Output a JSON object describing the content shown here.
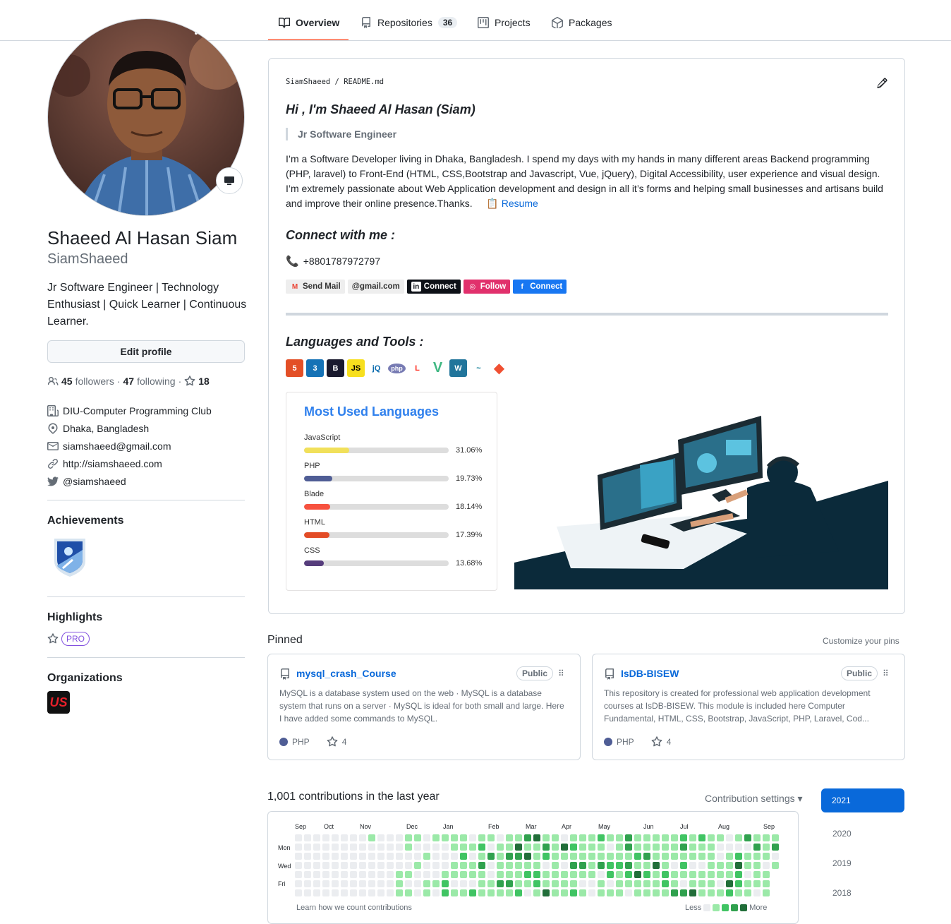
{
  "tabs": [
    {
      "label": "Overview",
      "icon": "book-icon",
      "active": true
    },
    {
      "label": "Repositories",
      "icon": "repo-icon",
      "count": "36"
    },
    {
      "label": "Projects",
      "icon": "project-icon"
    },
    {
      "label": "Packages",
      "icon": "package-icon"
    }
  ],
  "profile": {
    "full_name": "Shaeed Al Hasan Siam",
    "username": "SiamShaeed",
    "bio": "Jr Software Engineer | Technology Enthusiast | Quick Learner | Continuous Learner.",
    "edit_label": "Edit profile",
    "followers_count": "45",
    "followers_label": "followers",
    "following_count": "47",
    "following_label": "following",
    "stars_count": "18",
    "org": "DIU-Computer Programming Club",
    "location": "Dhaka, Bangladesh",
    "email": "siamshaeed@gmail.com",
    "website": "http://siamshaeed.com",
    "twitter": "@siamshaeed"
  },
  "sidebar": {
    "achievements_heading": "Achievements",
    "highlights_heading": "Highlights",
    "pro_label": "PRO",
    "organizations_heading": "Organizations",
    "org_badge_text": "US"
  },
  "readme": {
    "path_user": "SiamShaeed",
    "path_sep": "/",
    "path_file": "README.md",
    "greeting": "Hi , I'm Shaeed Al Hasan (Siam)",
    "role": "Jr Software Engineer",
    "about": "I’m a Software Developer living in Dhaka, Bangladesh. I spend my days with my hands in many different areas Backend programming (PHP, laravel) to Front-End (HTML, CSS,Bootstrap and Javascript, Vue, jQuery), Digital Accessibility, user experience and visual design. I’m extremely passionate about Web Application development and design in all it’s forms and helping small businesses and artisans build and improve their online presence.Thanks.",
    "resume_label": "Resume",
    "connect_heading": "Connect with me :",
    "phone": "+8801787972797",
    "badges": [
      {
        "label": "Send Mail",
        "icon": "gmail-icon",
        "bg": "#eeeeee",
        "fg": "#333333"
      },
      {
        "label": "@gmail.com",
        "icon": "",
        "bg": "#eeeeee",
        "fg": "#333333"
      },
      {
        "label": "Connect",
        "icon": "linkedin-icon",
        "bg": "#0d1117",
        "fg": "#ffffff"
      },
      {
        "label": "Follow",
        "icon": "instagram-icon",
        "bg": "#0d1117",
        "fg": "#ffffff"
      },
      {
        "label": "Connect",
        "icon": "facebook-icon",
        "bg": "#0d1117",
        "fg": "#ffffff"
      }
    ],
    "languages_heading": "Languages and Tools :",
    "tools": [
      {
        "name": "html5-icon",
        "glyph": "5",
        "bg": "#e34f26"
      },
      {
        "name": "css3-icon",
        "glyph": "3",
        "bg": "#1572b6"
      },
      {
        "name": "bootstrap-icon",
        "glyph": "B",
        "bg": "#1a1a2e"
      },
      {
        "name": "javascript-icon",
        "glyph": "JS",
        "bg": "#f7df1e"
      },
      {
        "name": "jquery-icon",
        "glyph": "jQ",
        "bg": "#ffffff"
      },
      {
        "name": "php-icon",
        "glyph": "php",
        "bg": "#777bb3"
      },
      {
        "name": "laravel-icon",
        "glyph": "L",
        "bg": "#ffffff"
      },
      {
        "name": "vue-icon",
        "glyph": "V",
        "bg": "#ffffff"
      },
      {
        "name": "wordpress-icon",
        "glyph": "W",
        "bg": "#21759b"
      },
      {
        "name": "mysql-icon",
        "glyph": "~",
        "bg": "#ffffff"
      },
      {
        "name": "git-icon",
        "glyph": "◆",
        "bg": "#ffffff"
      }
    ],
    "most_used": {
      "title": "Most Used Languages",
      "langs": [
        {
          "name": "JavaScript",
          "pct": "31.06%",
          "value": 31.06,
          "color": "#f1e05a"
        },
        {
          "name": "PHP",
          "pct": "19.73%",
          "value": 19.73,
          "color": "#4f5d95"
        },
        {
          "name": "Blade",
          "pct": "18.14%",
          "value": 18.14,
          "color": "#f7523f"
        },
        {
          "name": "HTML",
          "pct": "17.39%",
          "value": 17.39,
          "color": "#e34c26"
        },
        {
          "name": "CSS",
          "pct": "13.68%",
          "value": 13.68,
          "color": "#563d7c"
        }
      ]
    }
  },
  "pinned": {
    "heading": "Pinned",
    "customize": "Customize your pins",
    "repos": [
      {
        "name": "mysql_crash_Course",
        "visibility": "Public",
        "desc": "MySQL is a database system used on the web · MySQL is a database system that runs on a server · MySQL is ideal for both small and large. Here I have added some commands to MySQL.",
        "lang": "PHP",
        "stars": "4"
      },
      {
        "name": "IsDB-BISEW",
        "visibility": "Public",
        "desc": "This repository is created for professional web application development courses at IsDB-BISEW. This module is included here Computer Fundamental, HTML, CSS, Bootstrap, JavaScript, PHP, Laravel, Cod...",
        "lang": "PHP",
        "stars": "4"
      }
    ]
  },
  "contributions": {
    "heading": "1,001 contributions in the last year",
    "settings": "Contribution settings ▾",
    "months": [
      "Sep",
      "Oct",
      "Nov",
      "Dec",
      "Jan",
      "Feb",
      "Mar",
      "Apr",
      "May",
      "Jun",
      "Jul",
      "Aug",
      "Sep"
    ],
    "days": [
      "Mon",
      "Wed",
      "Fri"
    ],
    "learn": "Learn how we count contributions",
    "less": "Less",
    "more": "More",
    "level_colors": [
      "#ebedf0",
      "#9be9a8",
      "#40c463",
      "#30a14e",
      "#216e39"
    ],
    "years": [
      "2021",
      "2020",
      "2019",
      "2018"
    ],
    "selected_year": "2021"
  }
}
